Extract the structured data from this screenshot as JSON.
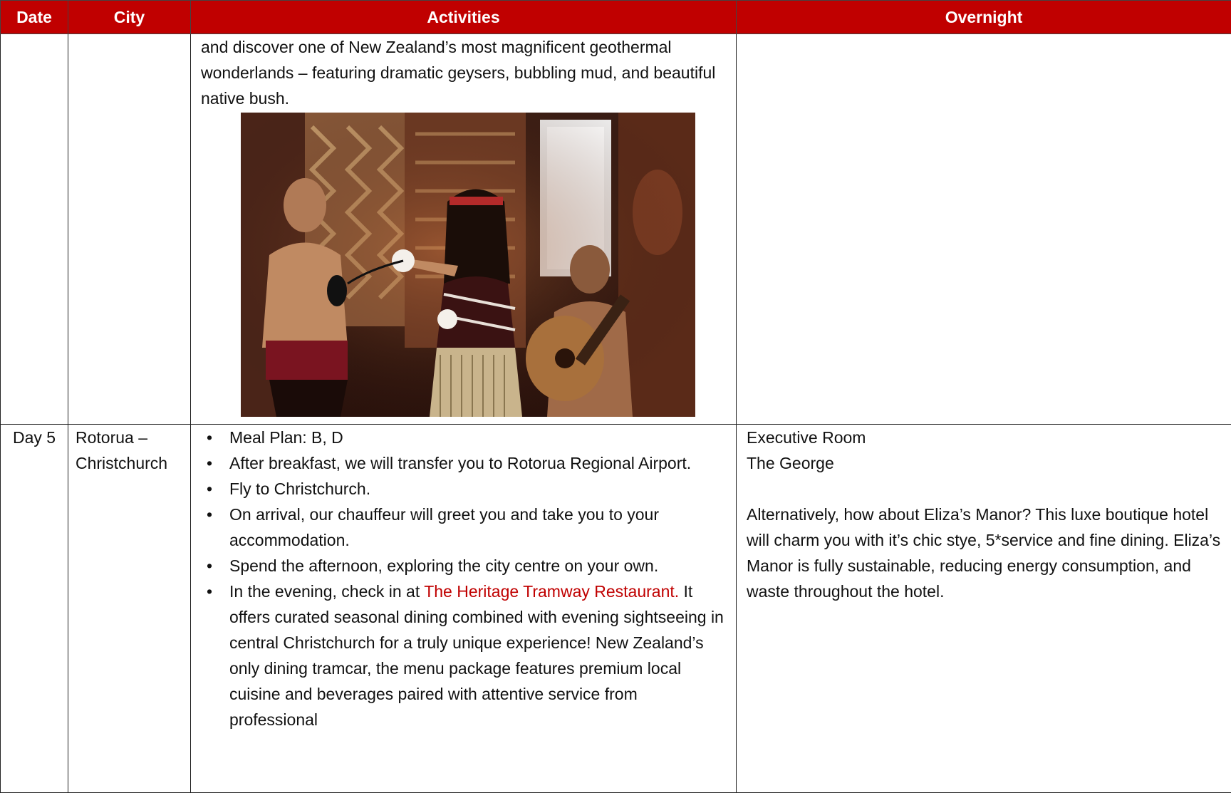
{
  "table": {
    "headers": [
      "Date",
      "City",
      "Activities",
      "Overnight"
    ],
    "row1": {
      "activities_intro": "and discover one of New Zealand’s most magnificent geothermal wonderlands – featuring dramatic geysers, bubbling mud, and beautiful native bush."
    },
    "row2": {
      "date": "Day 5",
      "city": "Rotorua – Christchurch",
      "activities": [
        "Meal Plan: B, D",
        "After breakfast, we will transfer you to Rotorua Regional Airport.",
        "Fly to Christchurch.",
        "On arrival, our chauffeur will greet you and take you to your accommodation.",
        "Spend the afternoon, exploring the city centre on your own."
      ],
      "evening_prefix": "In the evening, check in at ",
      "evening_link": "The Heritage Tramway Restaurant.",
      "evening_suffix": " It offers curated seasonal dining combined with evening sightseeing in central Christchurch for a truly unique experience! New Zealand’s only dining tramcar, the menu package features premium local cuisine and beverages paired with attentive service from professional",
      "overnight_room": "Executive Room",
      "overnight_hotel": "The George",
      "overnight_alt": "Alternatively, how about Eliza’s Manor? This luxe boutique hotel will charm you with it’s chic stye, 5*service and fine dining. Eliza’s Manor is fully sustainable, reducing energy consumption, and waste throughout the hotel."
    }
  },
  "colors": {
    "header_bg": "#c00000",
    "link": "#c00000"
  }
}
